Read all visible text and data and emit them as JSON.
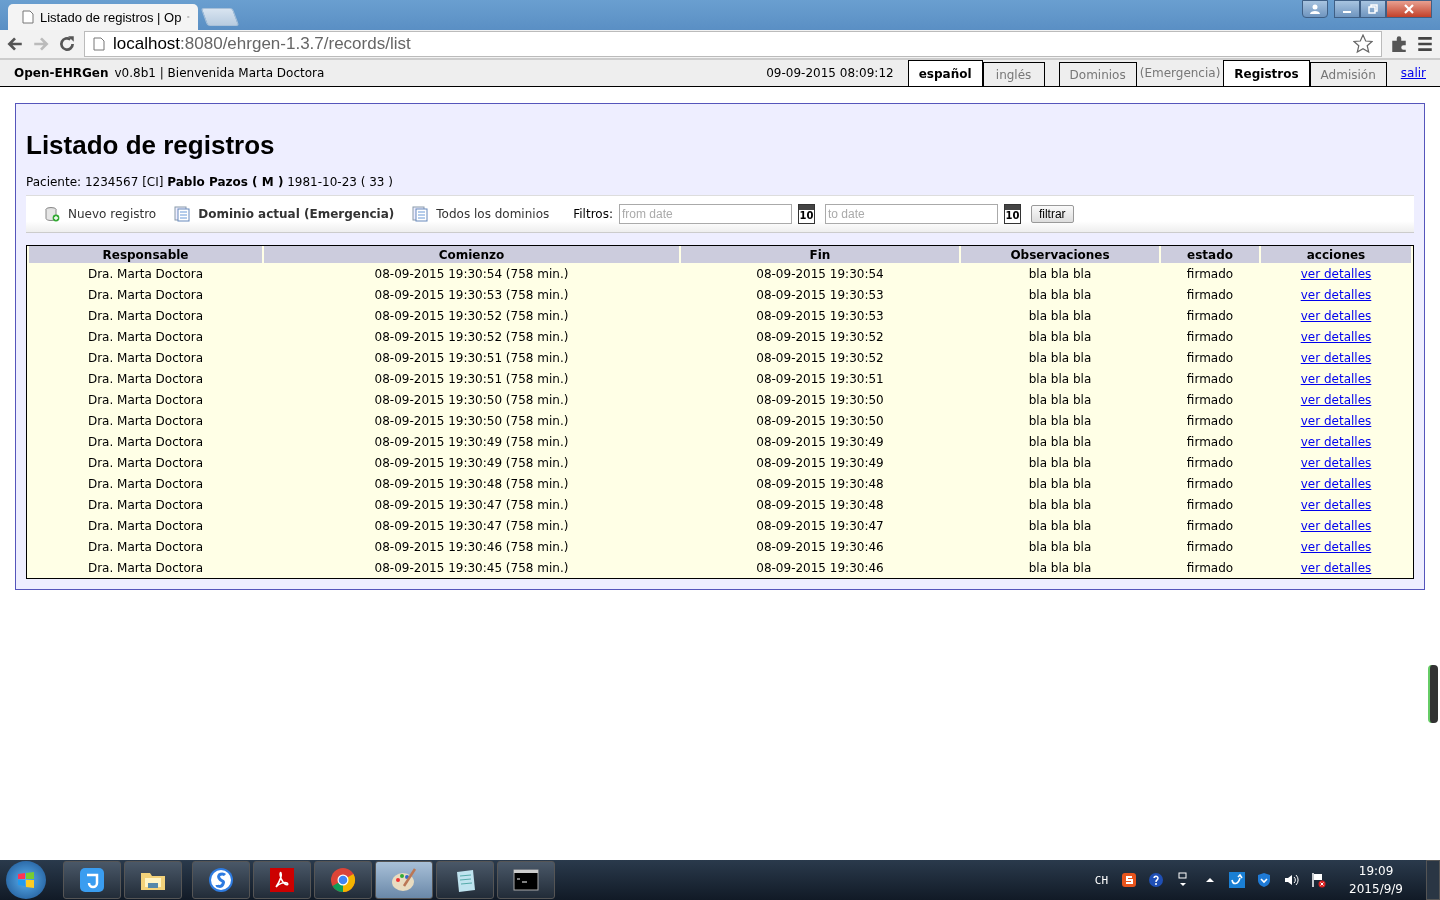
{
  "browser": {
    "tab_title": "Listado de registros | Op",
    "address_host": "localhost",
    "address_rest": ":8080/ehrgen-1.3.7/records/list"
  },
  "header": {
    "app_name": "Open-EHRGen",
    "version_greeting": "v0.8b1 | Bienvenida Marta Doctora",
    "datetime": "09-09-2015 08:09:12",
    "languages": [
      {
        "label": "español",
        "selected": true
      },
      {
        "label": "inglés",
        "selected": false
      }
    ],
    "menu": [
      {
        "label": "Dominios",
        "kind": "tab",
        "selected": false
      },
      {
        "label": "(Emergencia)",
        "kind": "label",
        "selected": false
      },
      {
        "label": "Registros",
        "kind": "tab",
        "selected": true
      },
      {
        "label": "Admisión",
        "kind": "tab",
        "selected": false
      }
    ],
    "logout": "salir"
  },
  "page": {
    "title": "Listado de registros",
    "patient_label": "Paciente:",
    "patient_id": "1234567 [CI]",
    "patient_name": "Pablo Pazos ( M )",
    "patient_birth": "1981-10-23 ( 33 )"
  },
  "toolbar": {
    "new_record": "Nuevo registro",
    "current_domain": "Dominio actual (Emergencia)",
    "all_domains": "Todos los dominios",
    "filters_label": "Filtros:",
    "from_placeholder": "from date",
    "to_placeholder": "to date",
    "from_calendar_day": "10",
    "to_calendar_day": "10",
    "filter_button": "filtrar"
  },
  "table": {
    "columns": [
      "Responsable",
      "Comienzo",
      "Fin",
      "Observaciones",
      "estado",
      "acciones"
    ],
    "rows": [
      [
        "Dra. Marta Doctora",
        "08-09-2015 19:30:54 (758 min.)",
        "08-09-2015 19:30:54",
        "bla bla bla",
        "firmado",
        "ver detalles"
      ],
      [
        "Dra. Marta Doctora",
        "08-09-2015 19:30:53 (758 min.)",
        "08-09-2015 19:30:53",
        "bla bla bla",
        "firmado",
        "ver detalles"
      ],
      [
        "Dra. Marta Doctora",
        "08-09-2015 19:30:52 (758 min.)",
        "08-09-2015 19:30:53",
        "bla bla bla",
        "firmado",
        "ver detalles"
      ],
      [
        "Dra. Marta Doctora",
        "08-09-2015 19:30:52 (758 min.)",
        "08-09-2015 19:30:52",
        "bla bla bla",
        "firmado",
        "ver detalles"
      ],
      [
        "Dra. Marta Doctora",
        "08-09-2015 19:30:51 (758 min.)",
        "08-09-2015 19:30:52",
        "bla bla bla",
        "firmado",
        "ver detalles"
      ],
      [
        "Dra. Marta Doctora",
        "08-09-2015 19:30:51 (758 min.)",
        "08-09-2015 19:30:51",
        "bla bla bla",
        "firmado",
        "ver detalles"
      ],
      [
        "Dra. Marta Doctora",
        "08-09-2015 19:30:50 (758 min.)",
        "08-09-2015 19:30:50",
        "bla bla bla",
        "firmado",
        "ver detalles"
      ],
      [
        "Dra. Marta Doctora",
        "08-09-2015 19:30:50 (758 min.)",
        "08-09-2015 19:30:50",
        "bla bla bla",
        "firmado",
        "ver detalles"
      ],
      [
        "Dra. Marta Doctora",
        "08-09-2015 19:30:49 (758 min.)",
        "08-09-2015 19:30:49",
        "bla bla bla",
        "firmado",
        "ver detalles"
      ],
      [
        "Dra. Marta Doctora",
        "08-09-2015 19:30:49 (758 min.)",
        "08-09-2015 19:30:49",
        "bla bla bla",
        "firmado",
        "ver detalles"
      ],
      [
        "Dra. Marta Doctora",
        "08-09-2015 19:30:48 (758 min.)",
        "08-09-2015 19:30:48",
        "bla bla bla",
        "firmado",
        "ver detalles"
      ],
      [
        "Dra. Marta Doctora",
        "08-09-2015 19:30:47 (758 min.)",
        "08-09-2015 19:30:48",
        "bla bla bla",
        "firmado",
        "ver detalles"
      ],
      [
        "Dra. Marta Doctora",
        "08-09-2015 19:30:47 (758 min.)",
        "08-09-2015 19:30:47",
        "bla bla bla",
        "firmado",
        "ver detalles"
      ],
      [
        "Dra. Marta Doctora",
        "08-09-2015 19:30:46 (758 min.)",
        "08-09-2015 19:30:46",
        "bla bla bla",
        "firmado",
        "ver detalles"
      ],
      [
        "Dra. Marta Doctora",
        "08-09-2015 19:30:45 (758 min.)",
        "08-09-2015 19:30:46",
        "bla bla bla",
        "firmado",
        "ver detalles"
      ]
    ]
  },
  "taskbar": {
    "tray_language": "CH",
    "clock_time": "19:09",
    "clock_date": "2015/9/9"
  }
}
